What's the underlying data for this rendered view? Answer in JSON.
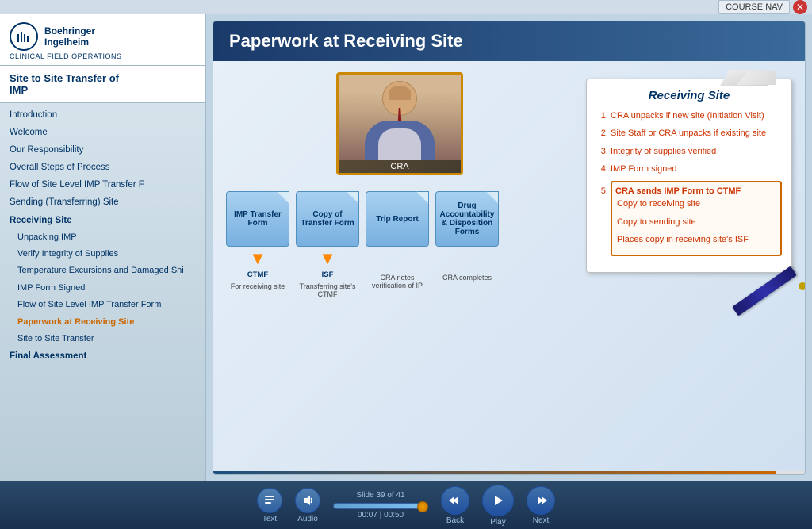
{
  "topbar": {
    "course_nav_label": "COURSE NAV",
    "close_icon": "✕"
  },
  "sidebar": {
    "logo_text_line1": "Boehringer",
    "logo_text_line2": "Ingelheim",
    "brand_sub": "CLINICAL FIELD OPERATIONS",
    "course_title_line1": "Site to Site Transfer of",
    "course_title_line2": "IMP",
    "nav_items": [
      {
        "label": "Introduction",
        "level": "top",
        "active": false
      },
      {
        "label": "Welcome",
        "level": "top",
        "active": false
      },
      {
        "label": "Our Responsibility",
        "level": "top",
        "active": false
      },
      {
        "label": "Overall Steps of Process",
        "level": "top",
        "active": false
      },
      {
        "label": "Flow of Site Level IMP Transfer F",
        "level": "top",
        "active": false
      },
      {
        "label": "Sending (Transferring) Site",
        "level": "top",
        "active": false
      },
      {
        "label": "Receiving Site",
        "level": "section",
        "active": false
      },
      {
        "label": "Unpacking IMP",
        "level": "sub",
        "active": false
      },
      {
        "label": "Verify Integrity of Supplies",
        "level": "sub",
        "active": false
      },
      {
        "label": "Temperature Excursions and Damaged Shi",
        "level": "sub",
        "active": false
      },
      {
        "label": "IMP Form Signed",
        "level": "sub",
        "active": false
      },
      {
        "label": "Flow of Site Level IMP Transfer Form",
        "level": "sub",
        "active": false
      },
      {
        "label": "Paperwork at Receiving Site",
        "level": "sub",
        "active": true
      },
      {
        "label": "Site to Site Transfer",
        "level": "sub",
        "active": false
      },
      {
        "label": "Final Assessment",
        "level": "top",
        "active": false
      }
    ]
  },
  "slide": {
    "title": "Paperwork at Receiving Site",
    "presenter_label": "CRA",
    "forms": [
      {
        "name": "IMP Transfer Form",
        "arrow": true,
        "dest": "CTMF",
        "desc": "For receiving site"
      },
      {
        "name": "Copy of Transfer Form",
        "arrow": true,
        "dest": "ISF",
        "desc": "Transferring site's CTMF"
      },
      {
        "name": "Trip Report",
        "arrow": false,
        "dest": "",
        "desc": "CRA notes verification of IP"
      },
      {
        "name": "Drug Accountability & Disposition Forms",
        "arrow": false,
        "dest": "",
        "desc": "CRA completes"
      }
    ],
    "notepad": {
      "title": "Receiving Site",
      "items": [
        {
          "text": "CRA unpacks if new site (Initiation Visit)",
          "highlighted": false
        },
        {
          "text": "Site Staff or CRA unpacks if existing site",
          "highlighted": false
        },
        {
          "text": "Integrity of supplies verified",
          "highlighted": false
        },
        {
          "text": "IMP Form signed",
          "highlighted": false
        },
        {
          "text": "CRA sends IMP Form to CTMF",
          "highlighted": true,
          "subitems": [
            "Copy to receiving site",
            "Copy to sending site",
            "Places copy in receiving site's ISF"
          ]
        }
      ]
    }
  },
  "bottombar": {
    "text_label": "Text",
    "audio_label": "Audio",
    "slide_label": "Slide",
    "slide_current": "39",
    "slide_total": "41",
    "time_current": "00:07",
    "time_total": "00:50",
    "back_label": "Back",
    "play_label": "Play",
    "next_label": "Next",
    "progress_percent": 95
  }
}
